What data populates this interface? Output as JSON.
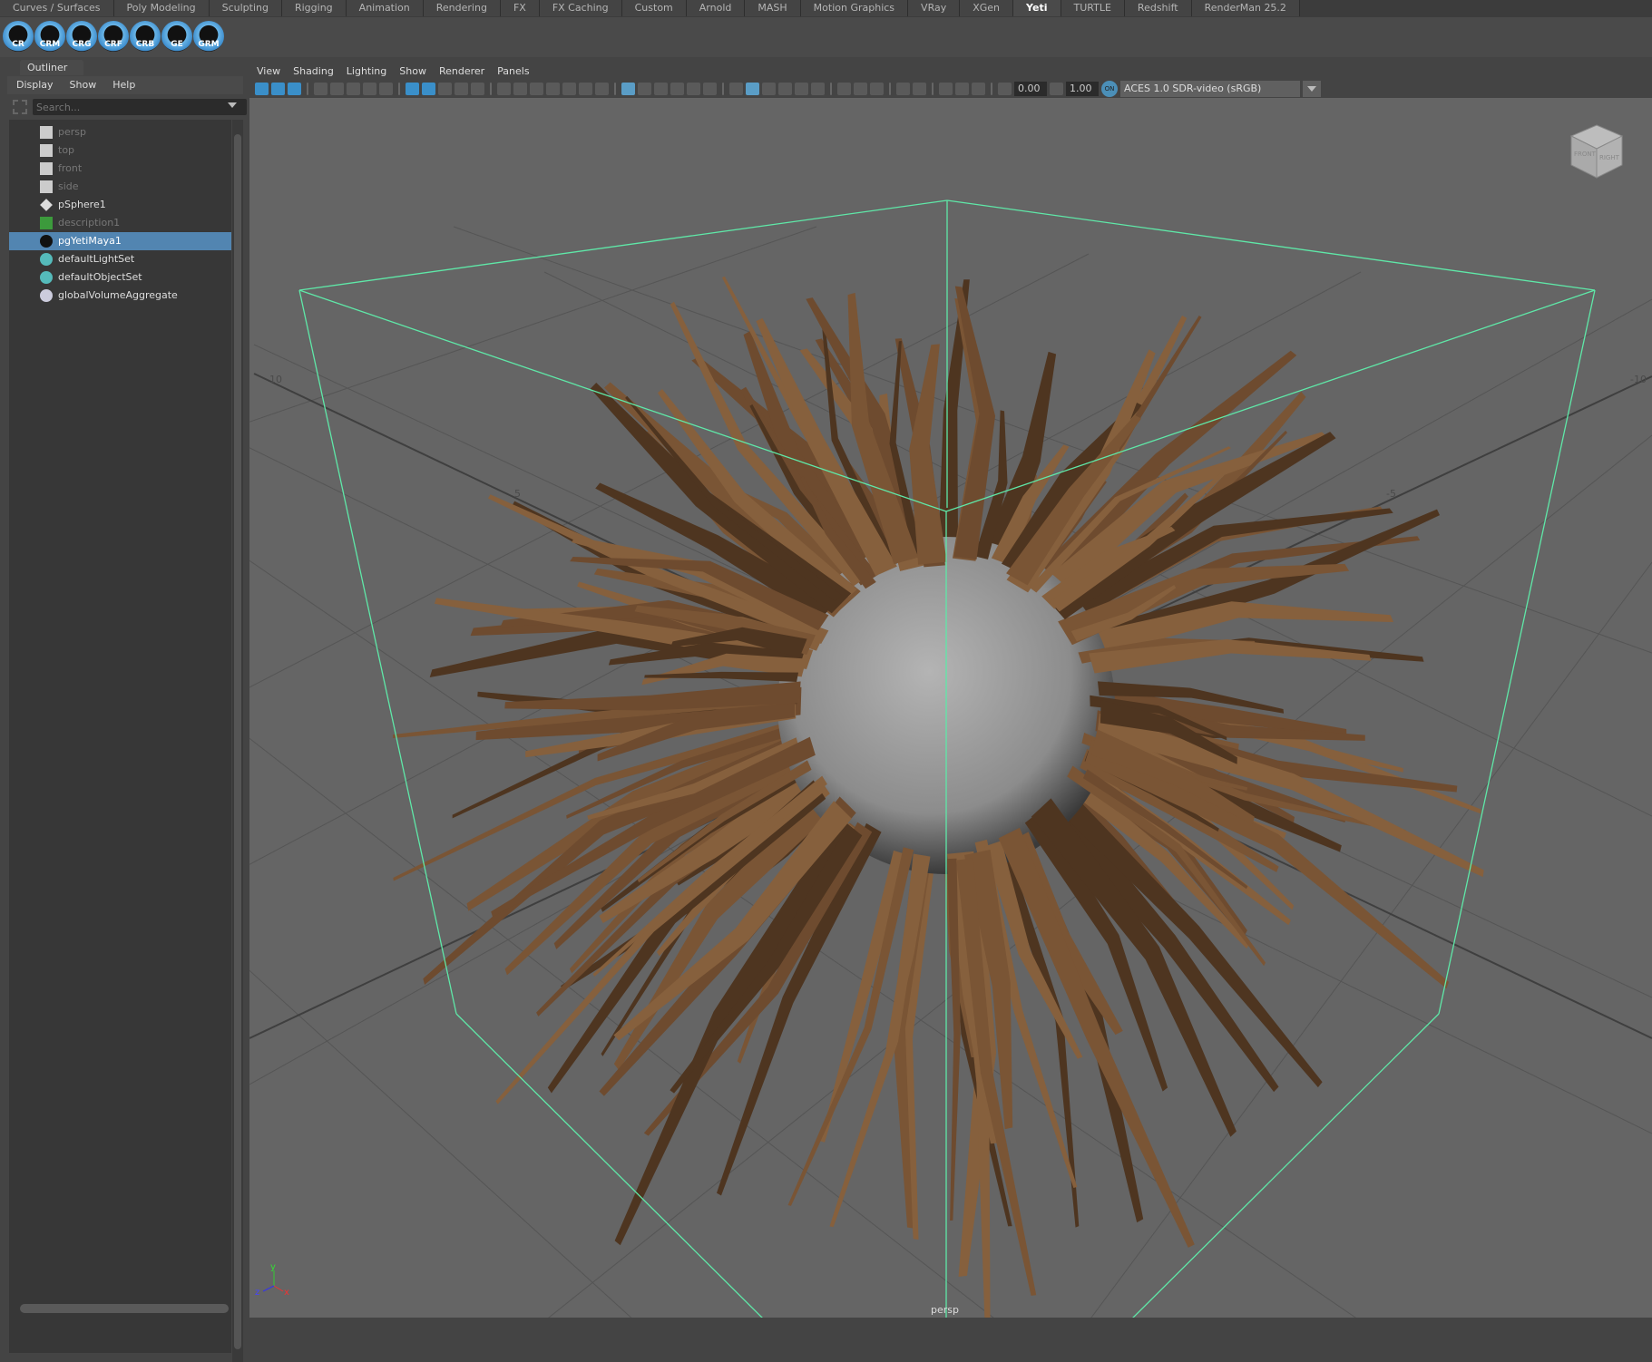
{
  "shelf_tabs": [
    "Curves / Surfaces",
    "Poly Modeling",
    "Sculpting",
    "Rigging",
    "Animation",
    "Rendering",
    "FX",
    "FX Caching",
    "Custom",
    "Arnold",
    "MASH",
    "Motion Graphics",
    "VRay",
    "XGen",
    "Yeti",
    "TURTLE",
    "Redshift",
    "RenderMan 25.2"
  ],
  "active_tab": "Yeti",
  "shelf_buttons": [
    "CR",
    "CRM",
    "CRG",
    "CRF",
    "CRB",
    "GE",
    "GRM"
  ],
  "outliner": {
    "tab": "Outliner",
    "menu": [
      "Display",
      "Show",
      "Help"
    ],
    "search_placeholder": "Search...",
    "items": [
      {
        "label": "persp",
        "icon": "camera-icon",
        "dim": true
      },
      {
        "label": "top",
        "icon": "camera-icon",
        "dim": true
      },
      {
        "label": "front",
        "icon": "camera-icon",
        "dim": true
      },
      {
        "label": "side",
        "icon": "camera-icon",
        "dim": true
      },
      {
        "label": "pSphere1",
        "icon": "transform-icon",
        "dim": false
      },
      {
        "label": "description1",
        "icon": "xgen-description-icon",
        "dim": true
      },
      {
        "label": "pgYetiMaya1",
        "icon": "yeti-icon",
        "dim": false,
        "selected": true
      },
      {
        "label": "defaultLightSet",
        "icon": "set-icon",
        "dim": false
      },
      {
        "label": "defaultObjectSet",
        "icon": "set-icon",
        "dim": false
      },
      {
        "label": "globalVolumeAggregate",
        "icon": "volume-icon",
        "dim": false
      }
    ]
  },
  "viewport": {
    "menu": [
      "View",
      "Shading",
      "Lighting",
      "Show",
      "Renderer",
      "Panels"
    ],
    "exposure": "0.00",
    "gamma": "1.00",
    "color_mgmt": "ON",
    "view_transform": "ACES 1.0 SDR-video (sRGB)",
    "camera": "persp",
    "grid_labels": [
      "10",
      "5",
      "-5",
      "-10"
    ],
    "axis": {
      "x": "x",
      "y": "y",
      "z": "z"
    },
    "viewcube": {
      "front": "FRONT",
      "right": "RIGHT"
    },
    "colors": {
      "bbox": "#5fe8a8",
      "hair": "#7a5535",
      "background": "#656565",
      "selection": "#5285b1"
    }
  }
}
